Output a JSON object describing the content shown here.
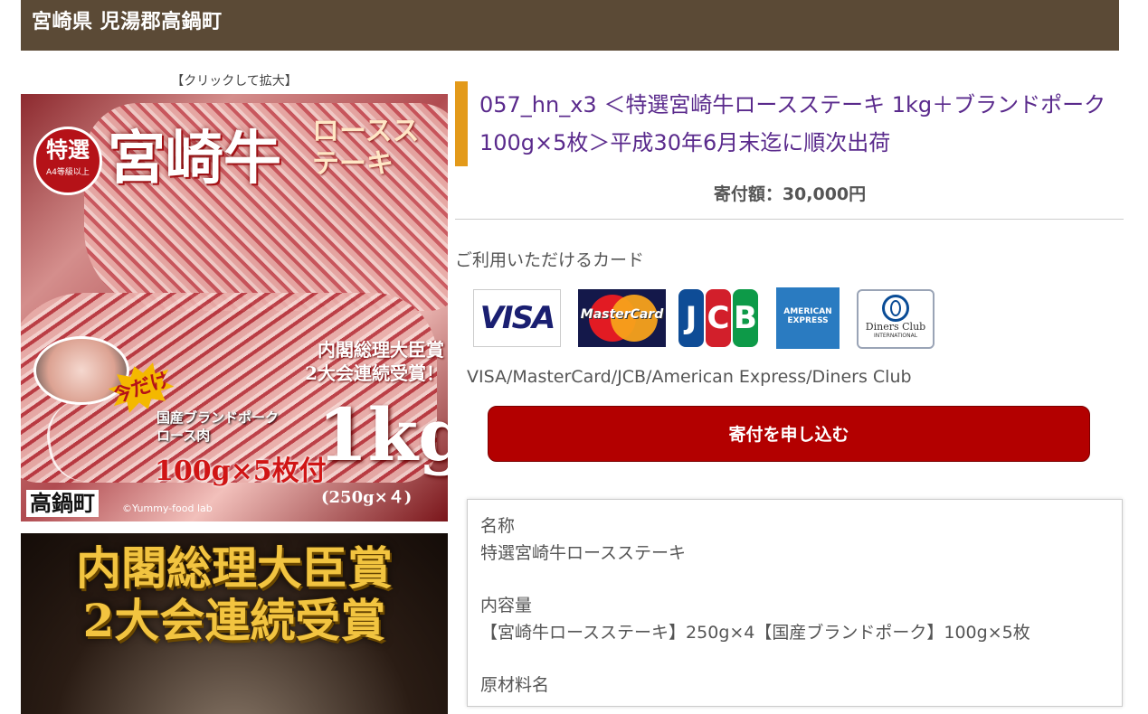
{
  "header": {
    "title": "宮崎県 児湯郡高鍋町"
  },
  "gallery": {
    "zoom_caption": "【クリックして拡大】",
    "image1": {
      "badge_main": "特選",
      "badge_sub": "A4等級以上",
      "brand": "宮崎牛",
      "cut": "ロースステーキ",
      "award_line1": "内閣総理大臣賞",
      "award_line2": "2大会連続受賞！",
      "limited": "今だけ",
      "pork_line1": "国産ブランドポーク",
      "pork_line2": "ロース肉",
      "pork_qty": "100g×5枚付",
      "weight": "1kg",
      "weight_detail": "(250g×４)",
      "town": "高鍋町",
      "copyright": "©Yummy-food lab"
    },
    "image2": {
      "award_line1": "内閣総理大臣賞",
      "award_line2": "2大会連続受賞"
    }
  },
  "product": {
    "title": "057_hn_x3 ＜特選宮崎牛ロースステーキ 1kg＋ブランドポーク100g×5枚＞平成30年6月末迄に順次出荷",
    "price": "寄付額：30,000円"
  },
  "payment": {
    "heading": "ご利用いただけるカード",
    "cards": [
      {
        "name": "VISA",
        "icon": "visa-logo"
      },
      {
        "name": "MasterCard",
        "icon": "mastercard-logo"
      },
      {
        "name": "JCB",
        "icon": "jcb-logo"
      },
      {
        "name": "AMERICAN EXPRESS",
        "icon": "amex-logo"
      },
      {
        "name": "Diners Club",
        "sub": "INTERNATIONAL",
        "icon": "diners-logo"
      }
    ],
    "card_list": "VISA/MasterCard/JCB/American Express/Diners Club"
  },
  "apply_button": "寄付を申し込む",
  "details": [
    {
      "label": "名称",
      "value": "特選宮崎牛ロースステーキ"
    },
    {
      "label": "内容量",
      "value": "【宮崎牛ロースステーキ】250g×4【国産ブランドポーク】100g×5枚"
    },
    {
      "label": "原材料名",
      "value": ""
    }
  ],
  "colors": {
    "header_bg": "#5b4a36",
    "title_accent": "#e39a1a",
    "title_text": "#5a2a8c",
    "button_bg": "#b30000"
  }
}
